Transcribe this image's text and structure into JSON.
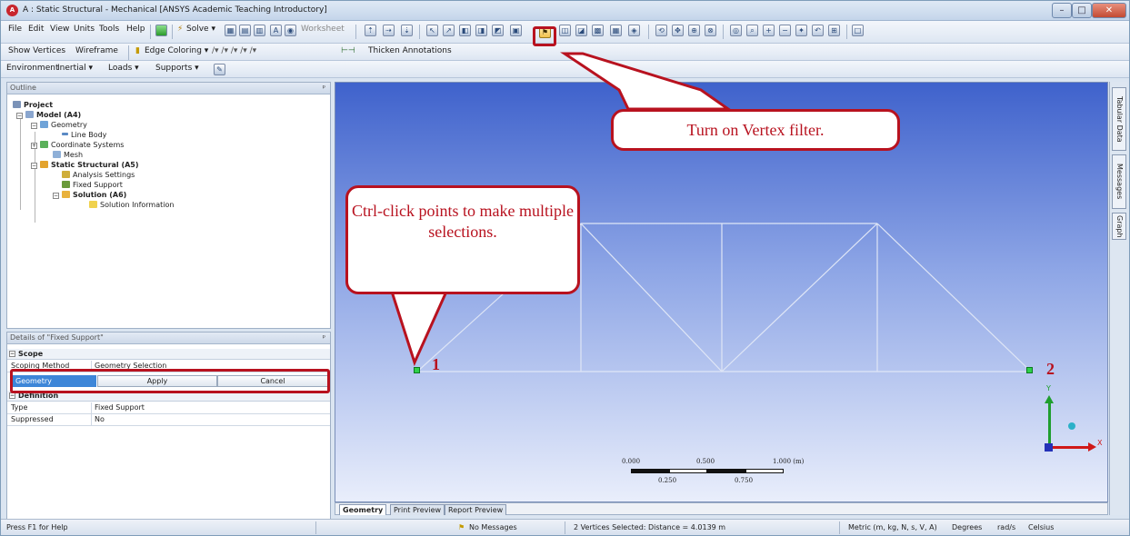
{
  "window": {
    "title": "A : Static Structural - Mechanical [ANSYS Academic Teaching Introductory]",
    "app_icon": "ansys-logo-icon",
    "controls": {
      "minimize": "–",
      "maximize": "□",
      "close": "✕"
    }
  },
  "toolbar1": {
    "file": "File",
    "edit": "Edit",
    "view": "View",
    "units": "Units",
    "tools": "Tools",
    "help": "Help",
    "solve": "Solve ▾",
    "worksheet": "Worksheet"
  },
  "toolbar2": {
    "show_vertices": "Show Vertices",
    "wireframe": "Wireframe",
    "edge_coloring": "Edge Coloring ▾",
    "thicken_annotations": "Thicken Annotations"
  },
  "toolbar3": {
    "environment": "Environment",
    "inertial": "Inertial ▾",
    "loads": "Loads ▾",
    "supports": "Supports ▾"
  },
  "outline": {
    "header": "Outline",
    "tree": [
      {
        "label": "Project"
      },
      {
        "label": "Model (A4)"
      },
      {
        "label": "Geometry"
      },
      {
        "label": "Line Body"
      },
      {
        "label": "Coordinate Systems"
      },
      {
        "label": "Mesh"
      },
      {
        "label": "Static Structural (A5)"
      },
      {
        "label": "Analysis Settings"
      },
      {
        "label": "Fixed Support"
      },
      {
        "label": "Solution (A6)"
      },
      {
        "label": "Solution Information"
      }
    ]
  },
  "details": {
    "header": "Details of \"Fixed Support\"",
    "scope_label": "Scope",
    "scoping_method_key": "Scoping Method",
    "scoping_method_value": "Geometry Selection",
    "geometry_key": "Geometry",
    "apply": "Apply",
    "cancel": "Cancel",
    "definition_label": "Definition",
    "type_key": "Type",
    "type_value": "Fixed Support",
    "suppressed_key": "Suppressed",
    "suppressed_value": "No"
  },
  "viewport": {
    "scale_ticks_top": [
      "0.000",
      "0.500",
      "1.000 (m)"
    ],
    "scale_ticks_bottom": [
      "0.250",
      "0.750"
    ],
    "axis_x": "X",
    "axis_y": "Y",
    "point_labels": [
      "1",
      "2"
    ]
  },
  "view_tabs": {
    "geometry": "Geometry",
    "print_preview": "Print Preview",
    "report_preview": "Report Preview"
  },
  "side_tabs": {
    "tabular_data": "Tabular Data",
    "messages": "Messages",
    "graph": "Graph"
  },
  "status": {
    "help": "Press F1 for Help",
    "messages": "No Messages",
    "selection": "2 Vertices Selected: Distance = 4.0139 m",
    "units": "Metric (m, kg, N, s, V, A)",
    "angle": "Degrees",
    "rate": "rad/s",
    "temperature": "Celsius"
  },
  "callouts": {
    "vertex_filter": "Turn on Vertex filter.",
    "ctrl_click": "Ctrl-click points to make multiple selections."
  },
  "colors": {
    "annotation_red": "#b8121f",
    "selected_vertex_green": "#2fd04a",
    "geometry_cell_blue": "#3d86d8"
  }
}
